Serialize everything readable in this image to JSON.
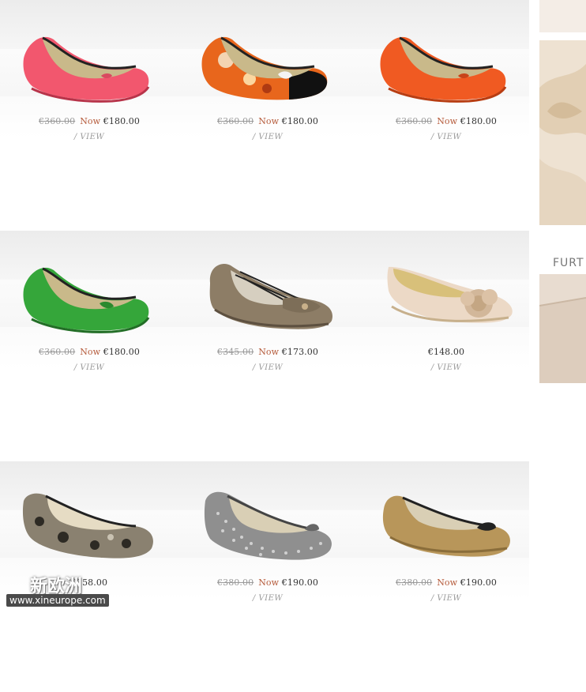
{
  "products": [
    {
      "old_price": "€360.00",
      "now_label": "Now",
      "price": "€180.00",
      "view": "/ VIEW",
      "color": "#f2576e",
      "style": "ballet"
    },
    {
      "old_price": "€360.00",
      "now_label": "Now",
      "price": "€180.00",
      "view": "/ VIEW",
      "color": "#e8661c",
      "style": "ballet-print"
    },
    {
      "old_price": "€360.00",
      "now_label": "Now",
      "price": "€180.00",
      "view": "/ VIEW",
      "color": "#f05a22",
      "style": "ballet"
    },
    {
      "old_price": "€360.00",
      "now_label": "Now",
      "price": "€180.00",
      "view": "/ VIEW",
      "color": "#35a63a",
      "style": "ballet"
    },
    {
      "old_price": "€345.00",
      "now_label": "Now",
      "price": "€173.00",
      "view": "/ VIEW",
      "color": "#8d7d66",
      "style": "moccasin"
    },
    {
      "old_price": "",
      "now_label": "",
      "price": "€148.00",
      "view": "/ VIEW",
      "color": "#ecd9c6",
      "style": "flower"
    },
    {
      "old_price": "",
      "now_label": "",
      "price": "€358.00",
      "view": "/ VIEW",
      "color": "#8a8170",
      "style": "leopard"
    },
    {
      "old_price": "€380.00",
      "now_label": "Now",
      "price": "€190.00",
      "view": "/ VIEW",
      "color": "#8f8f8f",
      "style": "studded"
    },
    {
      "old_price": "€380.00",
      "now_label": "Now",
      "price": "€190.00",
      "view": "/ VIEW",
      "color": "#b8965a",
      "style": "gold"
    }
  ],
  "sidebar": {
    "heading": "FURT"
  },
  "watermark": {
    "text_cn": "新欧洲",
    "url": "www.xineurope.com"
  }
}
